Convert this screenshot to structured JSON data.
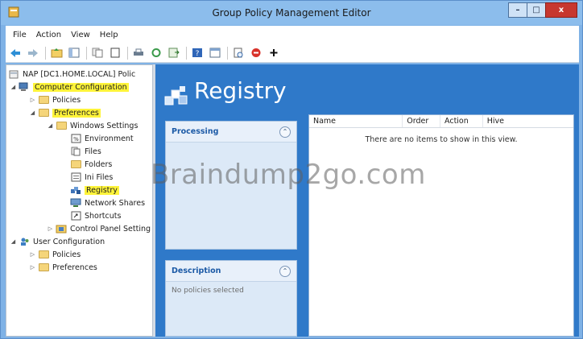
{
  "window": {
    "title": "Group Policy Management Editor"
  },
  "window_buttons": {
    "minimize": "–",
    "maximize": "□",
    "close": "x"
  },
  "menu": [
    "File",
    "Action",
    "View",
    "Help"
  ],
  "tree": {
    "root": "NAP [DC1.HOME.LOCAL] Polic",
    "computer_configuration": "Computer Configuration",
    "policies": "Policies",
    "preferences": "Preferences",
    "windows_settings": "Windows Settings",
    "environment": "Environment",
    "files": "Files",
    "folders": "Folders",
    "ini_files": "Ini Files",
    "registry": "Registry",
    "network_shares": "Network Shares",
    "shortcuts": "Shortcuts",
    "control_panel_settings": "Control Panel Setting",
    "user_configuration": "User Configuration",
    "user_policies": "Policies",
    "user_preferences": "Preferences"
  },
  "main": {
    "title": "Registry",
    "processing_title": "Processing",
    "description_title": "Description",
    "description_text": "No policies selected",
    "columns": [
      "Name",
      "Order",
      "Action",
      "Hive"
    ],
    "empty_message": "There are no items to show in this view."
  },
  "watermark": "Braindump2go.com",
  "colors": {
    "highlight": "#fff43a",
    "main_bg": "#2f79c9",
    "title_bar": "#8cbdec"
  }
}
